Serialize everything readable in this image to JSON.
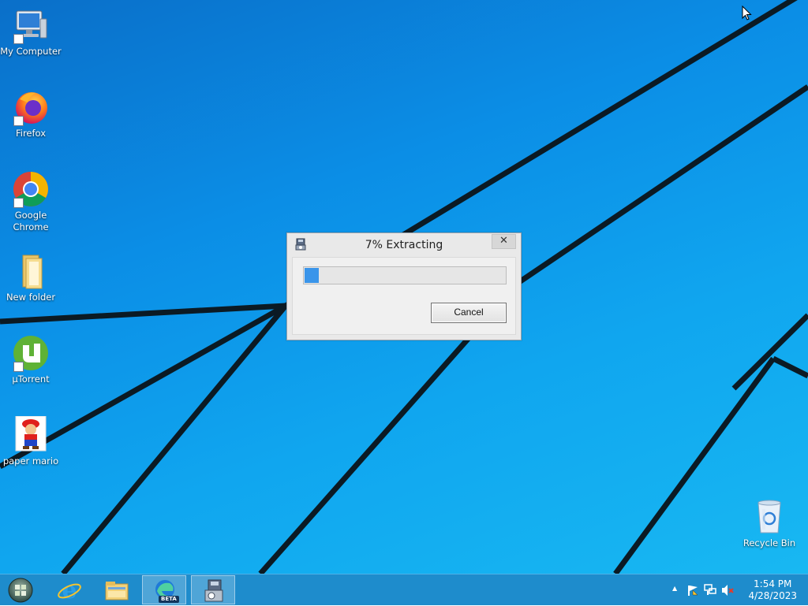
{
  "desktop": {
    "icons": [
      {
        "label": "My Computer",
        "icon": "computer-icon"
      },
      {
        "label": "Firefox",
        "icon": "firefox-icon"
      },
      {
        "label": "Google Chrome",
        "icon": "chrome-icon"
      },
      {
        "label": "New folder",
        "icon": "folder-icon"
      },
      {
        "label": "µTorrent",
        "icon": "utorrent-icon"
      },
      {
        "label": "paper mario",
        "icon": "paper-mario-icon"
      },
      {
        "label": "Recycle Bin",
        "icon": "recycle-bin-icon"
      }
    ]
  },
  "dialog": {
    "title": "7% Extracting",
    "progress_percent": 7,
    "cancel_label": "Cancel",
    "close_glyph": "✕"
  },
  "taskbar": {
    "items": [
      {
        "name": "start",
        "icon": "start-orb-icon"
      },
      {
        "name": "internet-explorer",
        "icon": "ie-icon"
      },
      {
        "name": "file-explorer",
        "icon": "file-explorer-icon"
      },
      {
        "name": "edge-beta",
        "icon": "edge-beta-icon",
        "badge": "BETA",
        "active": true
      },
      {
        "name": "extractor",
        "icon": "installer-icon",
        "active": true
      }
    ],
    "tray": {
      "overflow_glyph": "▲",
      "time": "1:54 PM",
      "date": "4/28/2023"
    }
  },
  "colors": {
    "desktop_blue": "#0b8ee6",
    "taskbar": "#1e8ccc",
    "progress_fill": "#3a95ea"
  }
}
